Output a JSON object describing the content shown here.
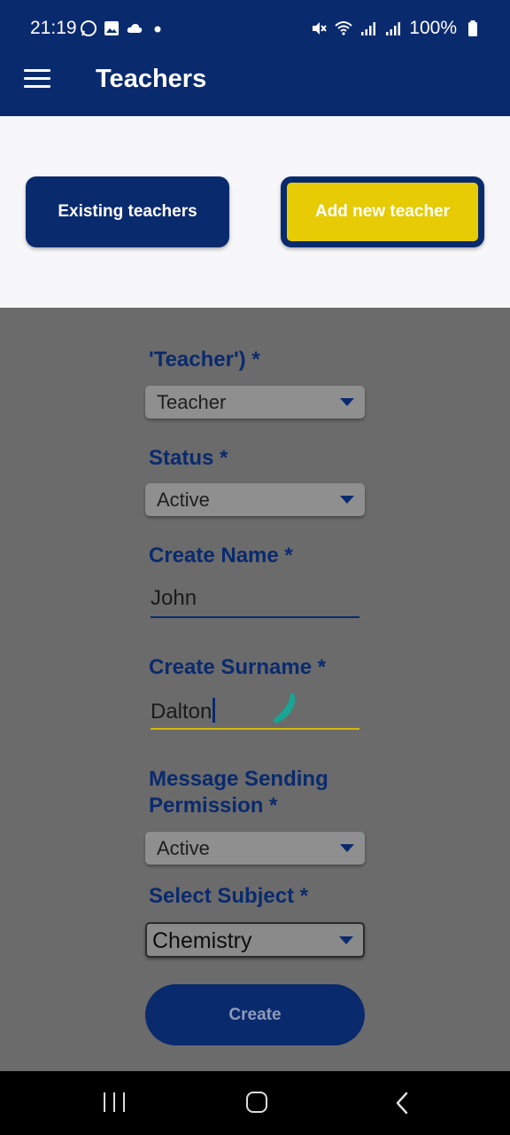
{
  "status_bar": {
    "time": "21:19",
    "battery": "100%",
    "left_icons": [
      "whatsapp-icon",
      "gallery-icon",
      "cloud-icon",
      "dot-icon"
    ],
    "right_icons": [
      "mute-icon",
      "wifi-icon",
      "signal-icon",
      "signal-icon",
      "battery-icon"
    ]
  },
  "app_bar": {
    "title": "Teachers",
    "menu_icon": "hamburger-menu-icon",
    "color": "#0a2a6e"
  },
  "toggle": {
    "existing_label": "Existing teachers",
    "add_label": "Add new teacher",
    "active": "add",
    "active_color": "#e6cb05"
  },
  "form": {
    "role": {
      "label": "'Teacher') *",
      "value": "Teacher"
    },
    "status": {
      "label": "Status *",
      "value": "Active"
    },
    "name": {
      "label": "Create Name *",
      "value": "John"
    },
    "surname": {
      "label": "Create Surname *",
      "value": "Dalton"
    },
    "permission": {
      "label_line1": "Message Sending",
      "label_line2": "Permission *",
      "value": "Active"
    },
    "subject": {
      "label": "Select Subject *",
      "value": "Chemistry"
    },
    "create_label": "Create"
  },
  "nav_bar": {
    "icons": [
      "recents-icon",
      "home-icon",
      "back-icon"
    ]
  }
}
